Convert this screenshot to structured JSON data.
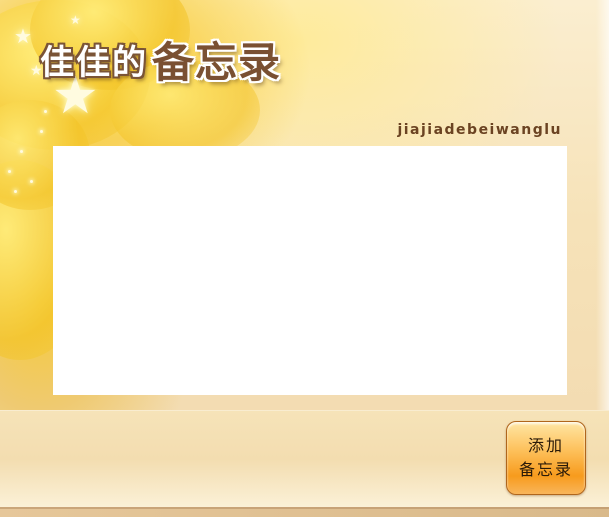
{
  "header": {
    "title_small": "佳佳的",
    "title_big": "备忘录",
    "subtitle": "jiajiadebeiwanglu"
  },
  "memo": {
    "content": ""
  },
  "footer": {
    "add_button_line1": "添加",
    "add_button_line2": "备忘录"
  },
  "decorations": {
    "star_icon": "star-icon",
    "accent_color": "#7a5032",
    "button_color": "#f79b1d"
  }
}
